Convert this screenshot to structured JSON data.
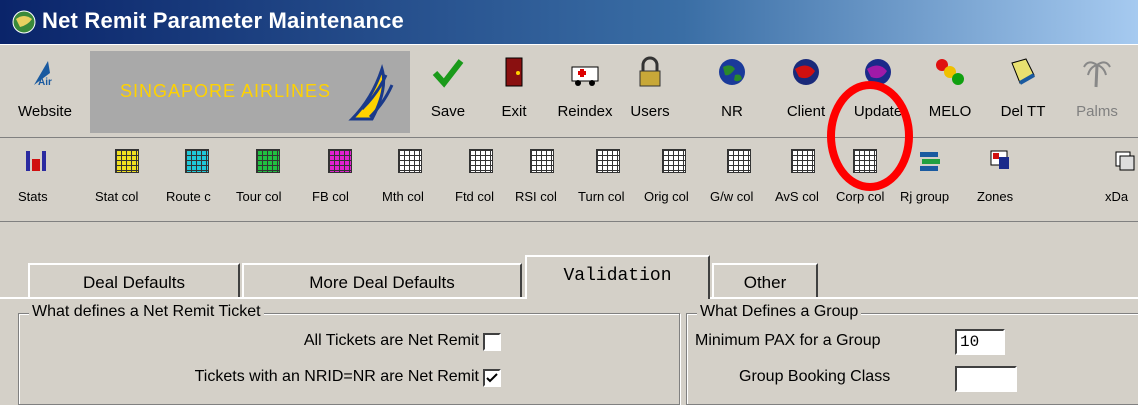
{
  "window": {
    "title": "Net Remit Parameter Maintenance"
  },
  "toolbar1": {
    "website": "Website",
    "logo_text": "SINGAPORE AIRLINES",
    "items": [
      {
        "label": "Save",
        "icon": "checkmark-icon"
      },
      {
        "label": "Exit",
        "icon": "door-icon"
      },
      {
        "label": "Reindex",
        "icon": "ambulance-icon"
      },
      {
        "label": "Users",
        "icon": "padlock-icon"
      },
      {
        "label": "NR",
        "icon": "globe-icon"
      },
      {
        "label": "Client",
        "icon": "globe-red-icon"
      },
      {
        "label": "Update",
        "icon": "globe-purple-icon"
      },
      {
        "label": "MELO",
        "icon": "traffic-light-icon"
      },
      {
        "label": "Del TT",
        "icon": "eraser-icon"
      },
      {
        "label": "Palms",
        "icon": "palm-tree-icon"
      }
    ]
  },
  "toolbar2": {
    "items": [
      {
        "label": "Stats"
      },
      {
        "label": "Stat col"
      },
      {
        "label": "Route c"
      },
      {
        "label": "Tour col"
      },
      {
        "label": "FB col"
      },
      {
        "label": "Mth col"
      },
      {
        "label": "Ftd col"
      },
      {
        "label": "RSI col"
      },
      {
        "label": "Turn col"
      },
      {
        "label": "Orig col"
      },
      {
        "label": "G/w col"
      },
      {
        "label": "AvS col"
      },
      {
        "label": "Corp col"
      },
      {
        "label": "Rj group"
      },
      {
        "label": "Zones"
      },
      {
        "label": "xDa"
      }
    ]
  },
  "tabs": [
    "Deal Defaults",
    "More Deal Defaults",
    "Validation",
    "Other"
  ],
  "groups": {
    "left": {
      "legend": "What defines a Net Remit Ticket",
      "row1": "All Tickets are Net Remit",
      "row1_checked": false,
      "row2": "Tickets with an NRID=NR are Net Remit",
      "row2_checked": true
    },
    "right": {
      "legend": "What Defines a Group",
      "row1": "Minimum PAX for a Group",
      "row1_value": "10",
      "row2": "Group Booking Class",
      "row2_value": ""
    }
  }
}
